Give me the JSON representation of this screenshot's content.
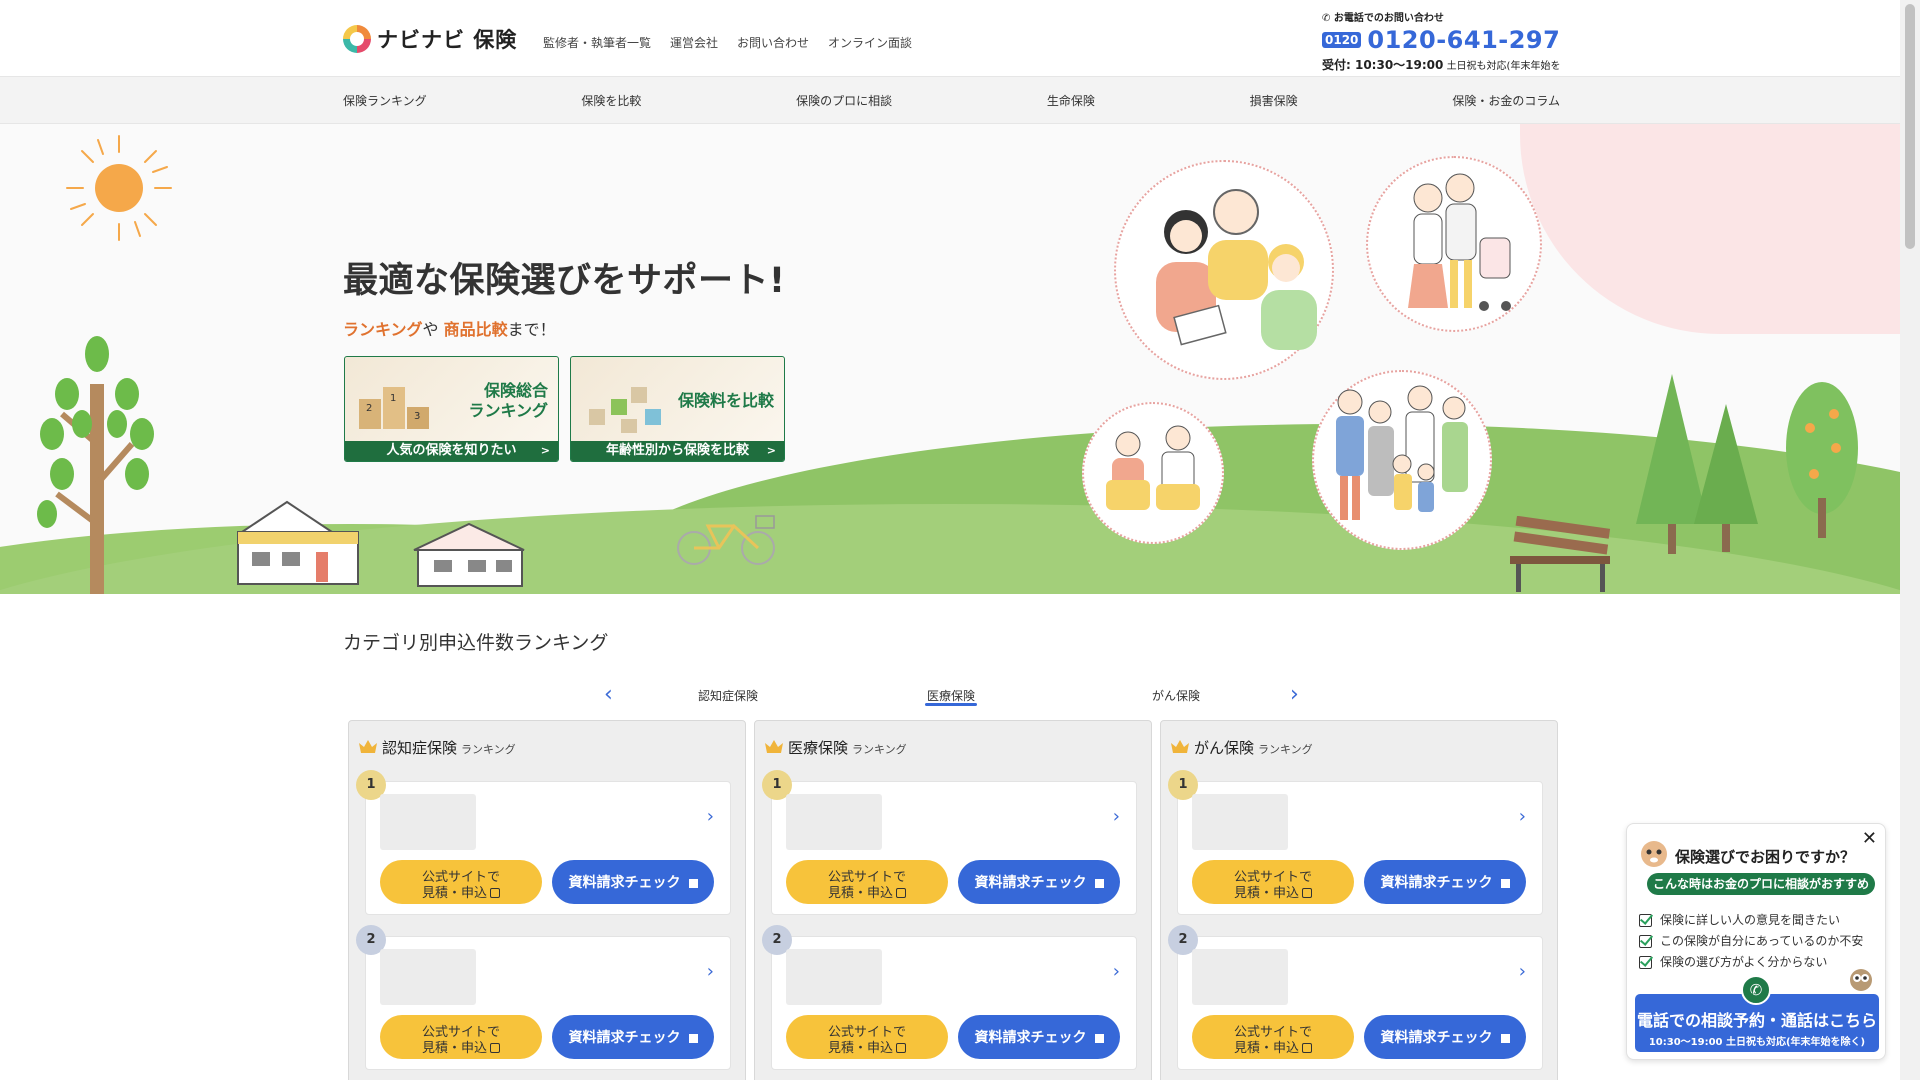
{
  "header": {
    "logo_text": "ナビナビ 保険",
    "links": [
      "監修者・執筆者一覧",
      "運営会社",
      "お問い合わせ",
      "オンライン面談"
    ],
    "contact_label": "お電話でのお問い合わせ",
    "freedial": "0120",
    "tel": "0120-641-297",
    "hours_main": "受付: 10:30〜19:00",
    "hours_note": "土日祝も対応(年末年始を除く)"
  },
  "nav": [
    "保険ランキング",
    "保険を比較",
    "保険のプロに相談",
    "生命保険",
    "損害保険",
    "保険・お金のコラム"
  ],
  "hero": {
    "title": "最適な保険選びをサポート!",
    "sub_accent_1": "ランキング",
    "sub_mid": "や",
    "sub_accent_2": "商品比較",
    "sub_end": "まで！",
    "card1": {
      "title_line1": "保険総合",
      "title_line2": "ランキング",
      "foot": "人気の保険を知りたい"
    },
    "card2": {
      "title_line1": "保険料を比較",
      "title_line2": "",
      "foot": "年齢性別から保険を比較"
    }
  },
  "ranking": {
    "section_title": "カテゴリ別申込件数ランキング",
    "tabs": [
      "認知症保険",
      "医療保険",
      "がん保険"
    ],
    "active_tab": "医療保険",
    "rank_suffix": "ランキング",
    "panels": [
      {
        "category": "認知症保険"
      },
      {
        "category": "医療保険"
      },
      {
        "category": "がん保険"
      }
    ],
    "btn_official_line1": "公式サイトで",
    "btn_official_line2": "見積・申込",
    "btn_request": "資料請求チェック",
    "rank_numbers": [
      "1",
      "2"
    ]
  },
  "widget": {
    "question": "保険選びでお困りですか？",
    "pill": "こんな時はお金のプロに相談がおすすめ",
    "items": [
      "保険に詳しい人の意見を聞きたい",
      "この保険が自分にあっているのか不安",
      "保険の選び方がよく分からない"
    ],
    "cta_main": "電話での相談予約・通話はこちら",
    "cta_sub": "10:30〜19:00 土日祝も対応(年末年始を除く)",
    "close": "✕"
  },
  "colors": {
    "brand_blue": "#3668d8",
    "brand_green": "#1f7a48",
    "accent_orange": "#e0722f",
    "button_yellow": "#f7c33b"
  }
}
